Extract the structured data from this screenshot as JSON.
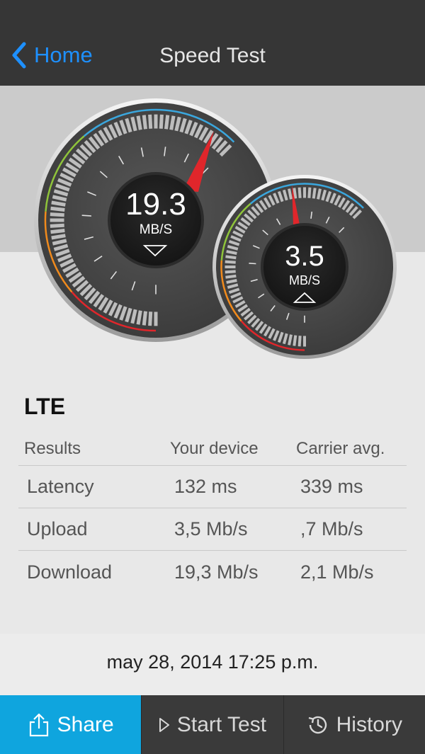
{
  "nav": {
    "back_label": "Home",
    "title": "Speed Test"
  },
  "download_gauge": {
    "value": "19.3",
    "unit": "MB/S",
    "direction": "down",
    "icon": "triangle-down-icon"
  },
  "upload_gauge": {
    "value": "3.5",
    "unit": "MB/S",
    "direction": "up",
    "icon": "triangle-up-icon"
  },
  "network": "LTE",
  "results": {
    "headers": [
      "Results",
      "Your device",
      "Carrier avg."
    ],
    "rows": [
      [
        "Latency",
        "132 ms",
        "339 ms"
      ],
      [
        "Upload",
        "3,5 Mb/s",
        ",7 Mb/s"
      ],
      [
        "Download",
        "19,3 Mb/s",
        "2,1 Mb/s"
      ]
    ]
  },
  "timestamp": "may 28, 2014 17:25 p.m.",
  "tabs": [
    {
      "label": "Share",
      "icon": "share-icon",
      "active": true
    },
    {
      "label": "Start Test",
      "icon": "play-icon",
      "active": false
    },
    {
      "label": "History",
      "icon": "history-icon",
      "active": false
    }
  ],
  "colors": {
    "accent": "#0fa5de",
    "link": "#1e90ff",
    "needle": "#e0262b",
    "navbar": "#363636"
  }
}
